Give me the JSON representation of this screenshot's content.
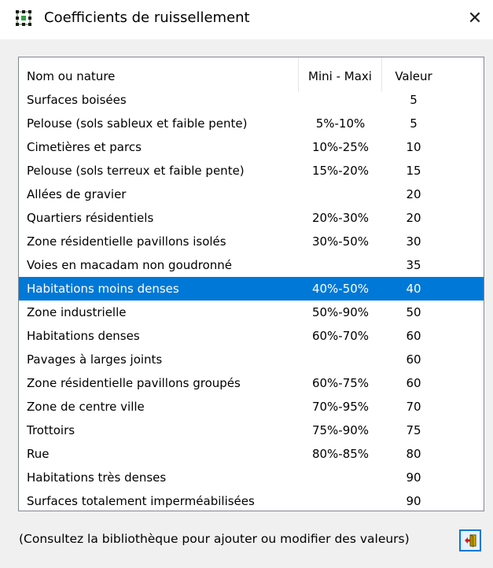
{
  "window": {
    "title": "Coefficients de ruissellement",
    "close_glyph": "✕",
    "icon": "grid-app-icon"
  },
  "table": {
    "columns": [
      "Nom ou nature",
      "Mini - Maxi",
      "Valeur"
    ],
    "rows": [
      {
        "name": "Surfaces boisées",
        "range": "",
        "value": "5"
      },
      {
        "name": "Pelouse (sols sableux et faible pente)",
        "range": "5%-10%",
        "value": "5"
      },
      {
        "name": "Cimetières et parcs",
        "range": "10%-25%",
        "value": "10"
      },
      {
        "name": "Pelouse (sols terreux et faible pente)",
        "range": "15%-20%",
        "value": "15"
      },
      {
        "name": "Allées de gravier",
        "range": "",
        "value": "20"
      },
      {
        "name": "Quartiers résidentiels",
        "range": "20%-30%",
        "value": "20"
      },
      {
        "name": "Zone résidentielle pavillons isolés",
        "range": "30%-50%",
        "value": "30"
      },
      {
        "name": "Voies en macadam non goudronné",
        "range": "",
        "value": "35"
      },
      {
        "name": "Habitations moins denses",
        "range": "40%-50%",
        "value": "40"
      },
      {
        "name": "Zone industrielle",
        "range": "50%-90%",
        "value": "50"
      },
      {
        "name": "Habitations denses",
        "range": "60%-70%",
        "value": "60"
      },
      {
        "name": "Pavages à larges joints",
        "range": "",
        "value": "60"
      },
      {
        "name": "Zone résidentielle pavillons groupés",
        "range": "60%-75%",
        "value": "60"
      },
      {
        "name": "Zone de centre ville",
        "range": "70%-95%",
        "value": "70"
      },
      {
        "name": "Trottoirs",
        "range": "75%-90%",
        "value": "75"
      },
      {
        "name": "Rue",
        "range": "80%-85%",
        "value": "80"
      },
      {
        "name": "Habitations très denses",
        "range": "",
        "value": "90"
      },
      {
        "name": "Surfaces totalement imperméabilisées",
        "range": "",
        "value": "90"
      }
    ],
    "selected_row": "Habitations moins denses",
    "selection_color": "#0078d7"
  },
  "footer": {
    "note": "(Consultez la bibliothèque pour ajouter ou modifier des valeurs)",
    "exit_button_icon": "exit-door-icon"
  }
}
